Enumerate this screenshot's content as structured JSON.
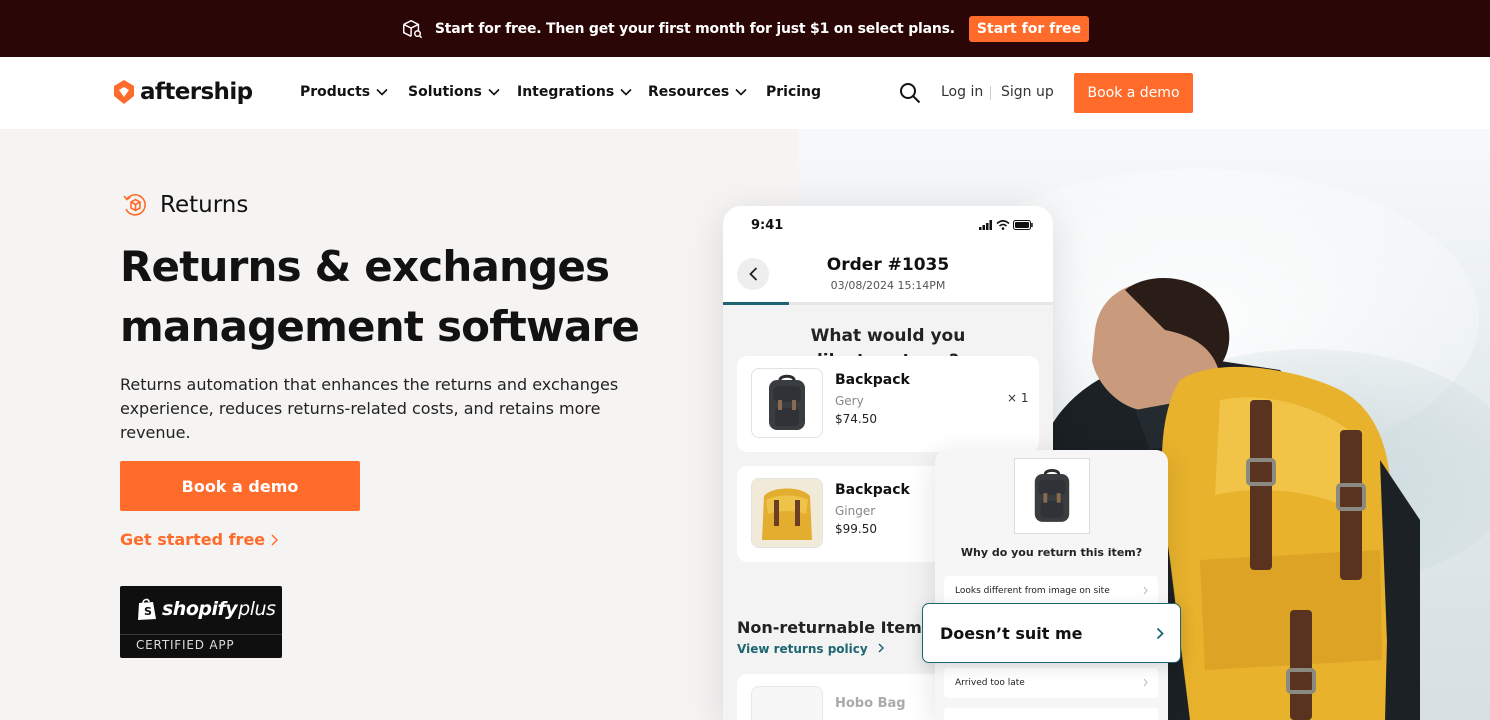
{
  "promo": {
    "text": "Start for free. Then get your first month for just $1 on select plans.",
    "button": "Start for free"
  },
  "nav": {
    "logo": "aftership",
    "items": [
      "Products",
      "Solutions",
      "Integrations",
      "Resources",
      "Pricing"
    ],
    "login": "Log in",
    "signup": "Sign up",
    "demo": "Book a demo"
  },
  "hero": {
    "tag": "Returns",
    "title_line1": "Returns & exchanges",
    "title_line2": "management software",
    "description": "Returns automation that enhances the returns and exchanges experience, reduces returns-related costs, and retains more revenue.",
    "demo_button": "Book a demo",
    "get_started": "Get started free",
    "badge": {
      "name": "shopify",
      "plus": "plus",
      "certified": "CERTIFIED APP"
    }
  },
  "phone": {
    "time": "9:41",
    "order": "Order #1035",
    "date": "03/08/2024 15:14PM",
    "question_line1": "What would you",
    "question_line2": "like to return ?",
    "items": [
      {
        "name": "Backpack",
        "color": "Gery",
        "price": "$74.50",
        "qty": "× 1"
      },
      {
        "name": "Backpack",
        "color": "Ginger",
        "price": "$99.50"
      }
    ],
    "non_returnable_title": "Non-returnable Items",
    "policy_link": "View returns policy",
    "hobo": "Hobo Bag"
  },
  "reason": {
    "question": "Why do you return this item?",
    "options": [
      "Looks different from image on site",
      "Arrived too late"
    ],
    "selected": "Doesn’t suit me"
  },
  "colors": {
    "brand_orange": "#ff6b2b",
    "promo_bg": "#2b0606",
    "teal": "#1d6571"
  }
}
